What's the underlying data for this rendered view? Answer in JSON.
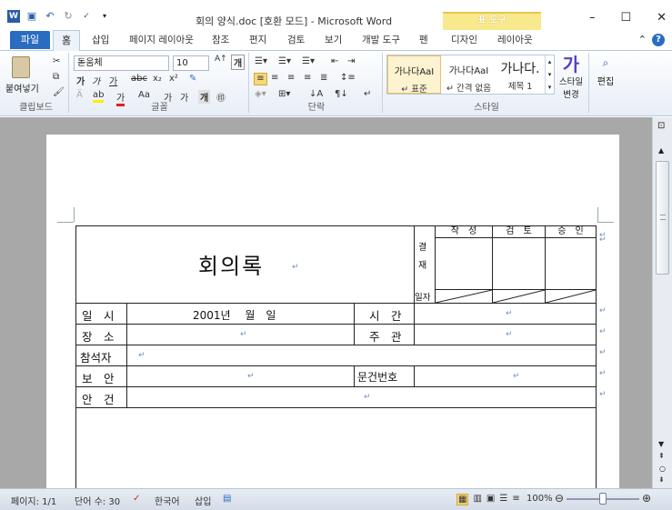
{
  "window": {
    "title": "회의 양식.doc [호환 모드] - Microsoft Word",
    "contextual_tab": "표 도구"
  },
  "tabs": [
    "파일",
    "홈",
    "삽입",
    "페이지 레이아웃",
    "참조",
    "편지",
    "검토",
    "보기",
    "개발 도구",
    "펜",
    "디자인",
    "레이아웃"
  ],
  "ribbon": {
    "clipboard": {
      "paste": "붙여넣기",
      "label": "클립보드"
    },
    "font": {
      "name": "돋움체",
      "size": "10",
      "label": "글꼴"
    },
    "paragraph": {
      "label": "단락"
    },
    "styles": {
      "items": [
        {
          "sample": "가나다AaI",
          "name": "↵ 표준"
        },
        {
          "sample": "가나다AaI",
          "name": "↵ 간격 없음"
        },
        {
          "sample": "가나다.",
          "name": "제목 1"
        }
      ],
      "change_style": "스타일\n변경",
      "change_style_line1": "스타일",
      "change_style_line2": "변경",
      "label": "스타일"
    },
    "editing": {
      "label": "편집"
    }
  },
  "document": {
    "title": "회의록",
    "approval": {
      "label": "결재",
      "label1": "결",
      "label2": "재",
      "headers": [
        "작　성",
        "검　토",
        "승　인"
      ],
      "date_label": "일자"
    },
    "rows": [
      {
        "label": "일　시",
        "value": "2001년　 월　일",
        "right_label": "시　간",
        "right_value": ""
      },
      {
        "label": "장　소",
        "value": "",
        "right_label": "주　관",
        "right_value": ""
      },
      {
        "label": "참석자",
        "value": ""
      },
      {
        "label": "보　안",
        "value": "",
        "right_label": "문건번호",
        "right_value": ""
      },
      {
        "label": "안　건",
        "value": ""
      }
    ]
  },
  "statusbar": {
    "page": "페이지: 1/1",
    "words": "단어 수: 30",
    "language": "한국어",
    "mode": "삽입",
    "zoom": "100%",
    "zoom_level": 0.5
  }
}
